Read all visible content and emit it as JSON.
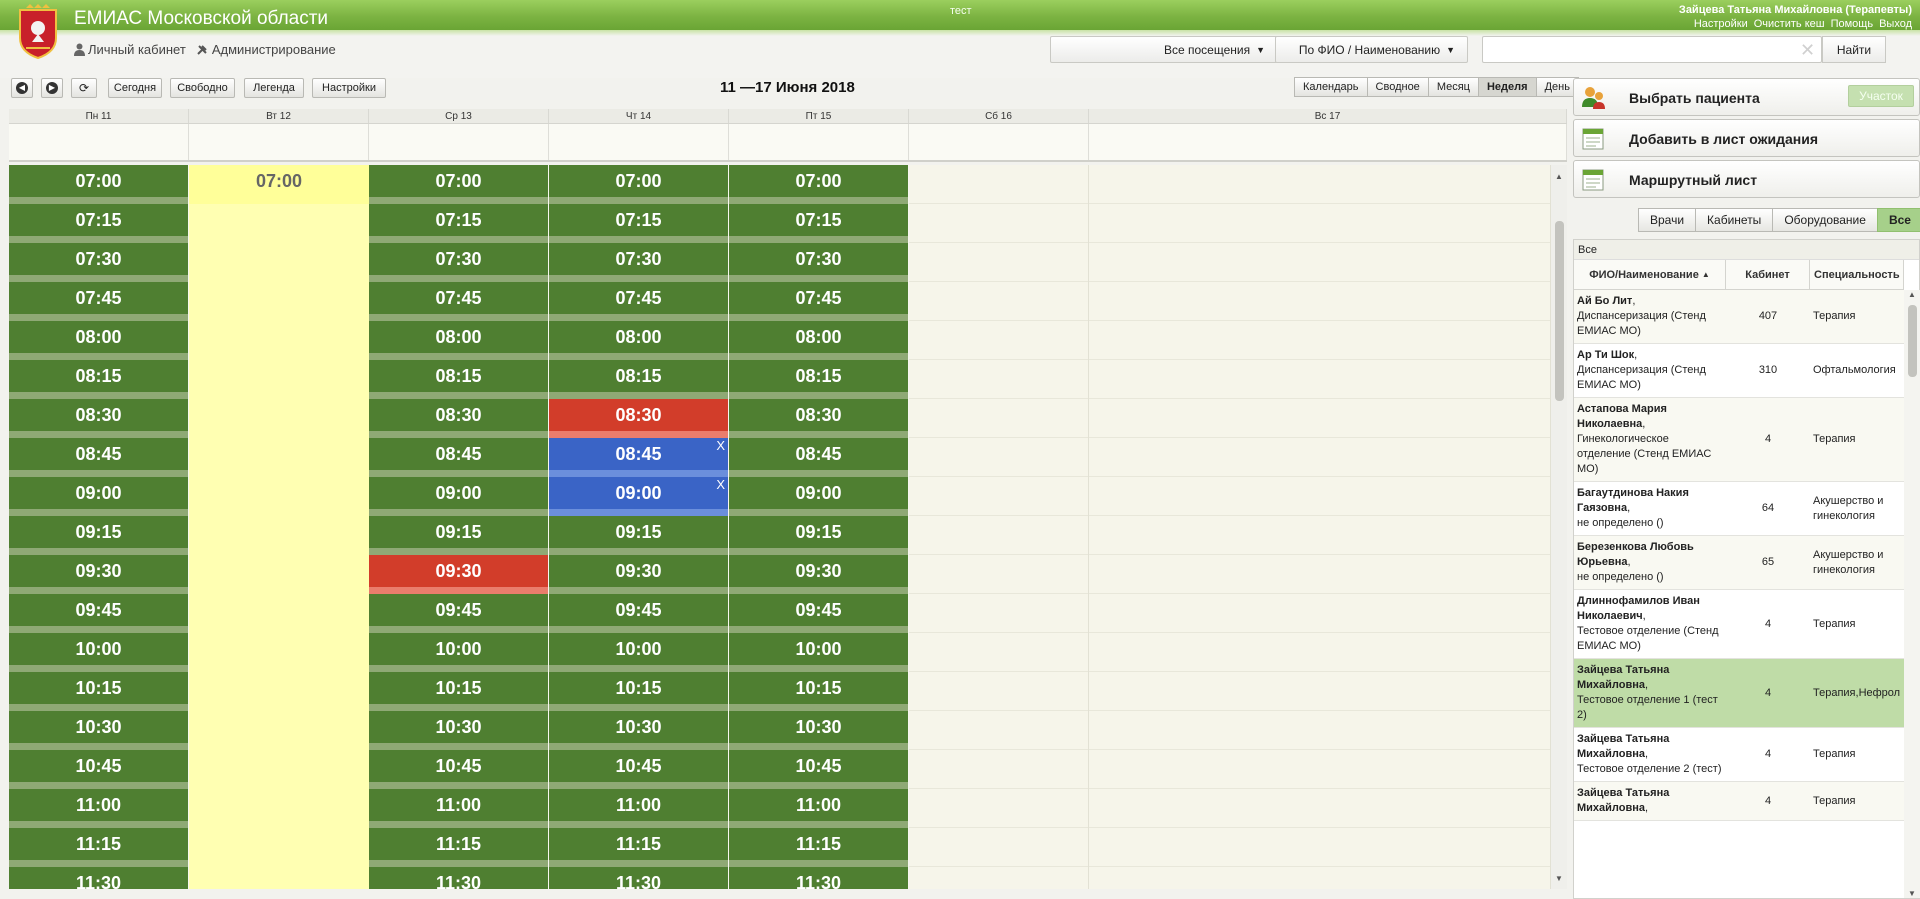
{
  "header": {
    "app_title": "ЕМИАС Московской области",
    "env_label": "тест",
    "user_name": "Зайцева Татьяна Михайловна (Терапевты)",
    "links": [
      "Настройки",
      "Очистить кеш",
      "Помощь",
      "Выход"
    ],
    "nav": {
      "cabinet": "Личный кабинет",
      "admin": "Администрирование"
    },
    "visits_dropdown": "Все посещения",
    "search_by_dropdown": "По ФИО / Наименованию",
    "search": {
      "value": "",
      "placeholder": ""
    },
    "find_button": "Найти"
  },
  "toolbar": {
    "today": "Сегодня",
    "free": "Свободно",
    "legend": "Легенда",
    "settings": "Настройки",
    "week_title": "11 —17 Июня 2018",
    "views": [
      "Календарь",
      "Сводное",
      "Месяц",
      "Неделя",
      "День"
    ],
    "active_view": "Неделя"
  },
  "calendar": {
    "days": [
      "Пн 11",
      "Вт 12",
      "Ср 13",
      "Чт 14",
      "Пт 15",
      "Сб 16",
      "Вс 17"
    ],
    "times": [
      "07:00",
      "07:15",
      "07:30",
      "07:45",
      "08:00",
      "08:15",
      "08:30",
      "08:45",
      "09:00",
      "09:15",
      "09:30",
      "09:45",
      "10:00",
      "10:15",
      "10:30",
      "10:45",
      "11:00",
      "11:15",
      "11:30"
    ],
    "columns": [
      {
        "day": "Пн 11",
        "kind": "slots"
      },
      {
        "day": "Вт 12",
        "kind": "yellow",
        "label": "07:00"
      },
      {
        "day": "Ср 13",
        "kind": "slots",
        "special": {
          "09:30": "red"
        }
      },
      {
        "day": "Чт 14",
        "kind": "slots",
        "special": {
          "08:30": "red",
          "08:45": "blue",
          "09:00": "blue"
        }
      },
      {
        "day": "Пт 15",
        "kind": "slots"
      },
      {
        "day": "Сб 16",
        "kind": "empty"
      },
      {
        "day": "Вс 17",
        "kind": "empty"
      }
    ],
    "cancel_mark": "X",
    "colors": {
      "free": "#4f7f31",
      "busy": "#d23d2a",
      "mine": "#3a64c6",
      "no_reception": "#ffffb2"
    }
  },
  "right_panel": {
    "choose_patient": "Выбрать пациента",
    "district": "Участок",
    "add_waitlist": "Добавить в лист ожидания",
    "route_sheet": "Маршрутный лист",
    "filters": [
      "Врачи",
      "Кабинеты",
      "Оборудование",
      "Все"
    ],
    "active_filter": "Все",
    "table": {
      "caption": "Все",
      "columns": [
        "ФИО/Наименование",
        "Кабинет",
        "Специальность"
      ],
      "sort_indicator": "▲",
      "rows": [
        {
          "name": "Ай Бо Лит",
          "dept": "Диспансеризация (Стенд ЕМИАС МО)",
          "room": "407",
          "spec": "Терапия",
          "selected": false
        },
        {
          "name": "Ар Ти Шок",
          "dept": "Диспансеризация (Стенд ЕМИАС МО)",
          "room": "310",
          "spec": "Офтальмология",
          "selected": false
        },
        {
          "name": "Астапова Мария Николаевна",
          "dept": "Гинекологическое отделение (Стенд ЕМИАС МО)",
          "room": "4",
          "spec": "Терапия",
          "selected": false
        },
        {
          "name": "Багаутдинова Накия Гаязовна",
          "dept": "не определено ()",
          "room": "64",
          "spec": "Акушерство и гинекология",
          "selected": false
        },
        {
          "name": "Березенкова Любовь Юрьевна",
          "dept": "не определено ()",
          "room": "65",
          "spec": "Акушерство и гинекология",
          "selected": false
        },
        {
          "name": "Длиннофамилов Иван Николаевич",
          "dept": "Тестовое отделение (Стенд ЕМИАС МО)",
          "room": "4",
          "spec": "Терапия",
          "selected": false
        },
        {
          "name": "Зайцева Татьяна Михайловна",
          "dept": "Тестовое отделение 1 (тест 2)",
          "room": "4",
          "spec": "Терапия,Нефрол",
          "selected": true
        },
        {
          "name": "Зайцева Татьяна Михайловна",
          "dept": "Тестовое отделение 2 (тест)",
          "room": "4",
          "spec": "Терапия",
          "selected": false
        },
        {
          "name": "Зайцева Татьяна Михайловна",
          "dept": "",
          "room": "4",
          "spec": "Терапия",
          "selected": false
        }
      ]
    }
  }
}
